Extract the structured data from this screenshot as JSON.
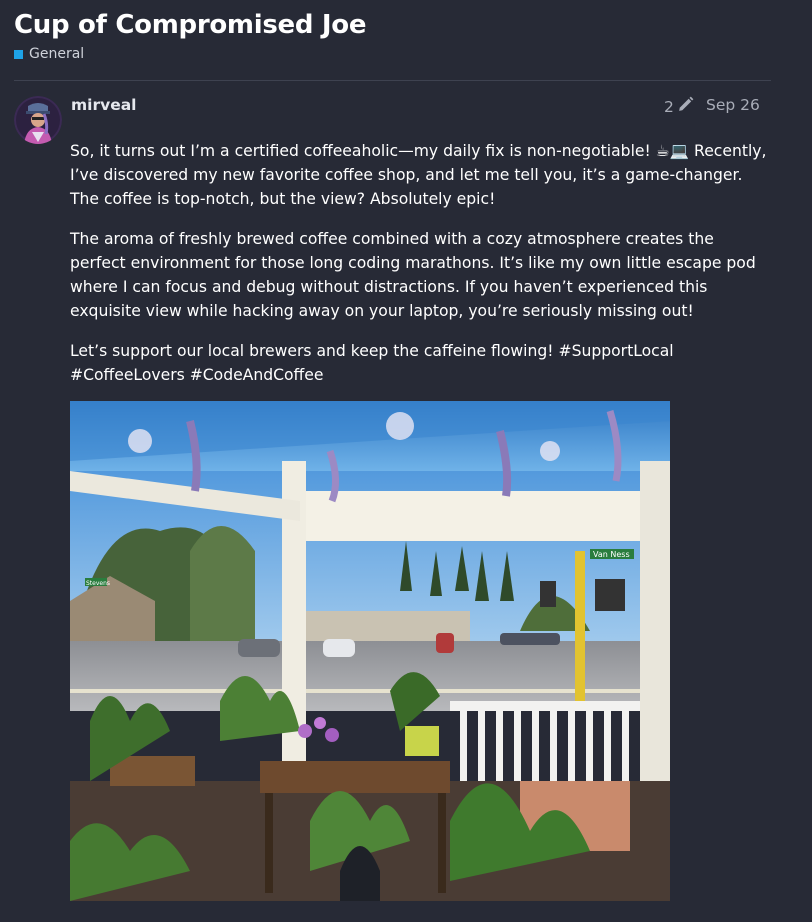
{
  "topic": {
    "title": "Cup of Compromised Joe",
    "category": "General",
    "category_color": "#1ea2e6"
  },
  "post": {
    "username": "mirveal",
    "edit_count": "2",
    "date": "Sep 26",
    "paragraphs": [
      "So, it turns out I’m a certified coffeeaholic—my daily fix is non-negotiable! ☕💻 Recently, I’ve discovered my new favorite coffee shop, and let me tell you, it’s a game-changer. The coffee is top-notch, but the view? Absolutely epic!",
      "The aroma of freshly brewed coffee combined with a cozy atmosphere creates the perfect environment for those long coding marathons. It’s like my own little escape pod where I can focus and debug without distractions. If you haven’t experienced this exquisite view while hacking away on your laptop, you’re seriously missing out!",
      "Let’s support our local brewers and keep the caffeine flowing! #SupportLocal #CoffeeLovers #CodeAndCoffee"
    ],
    "image": {
      "street_sign": "Van Ness",
      "small_sign": "Stevens"
    }
  },
  "icons": {
    "edit": "pencil-icon"
  },
  "colors": {
    "background": "#272a36",
    "divider": "#3e4250",
    "muted_text": "#a9adb8"
  }
}
